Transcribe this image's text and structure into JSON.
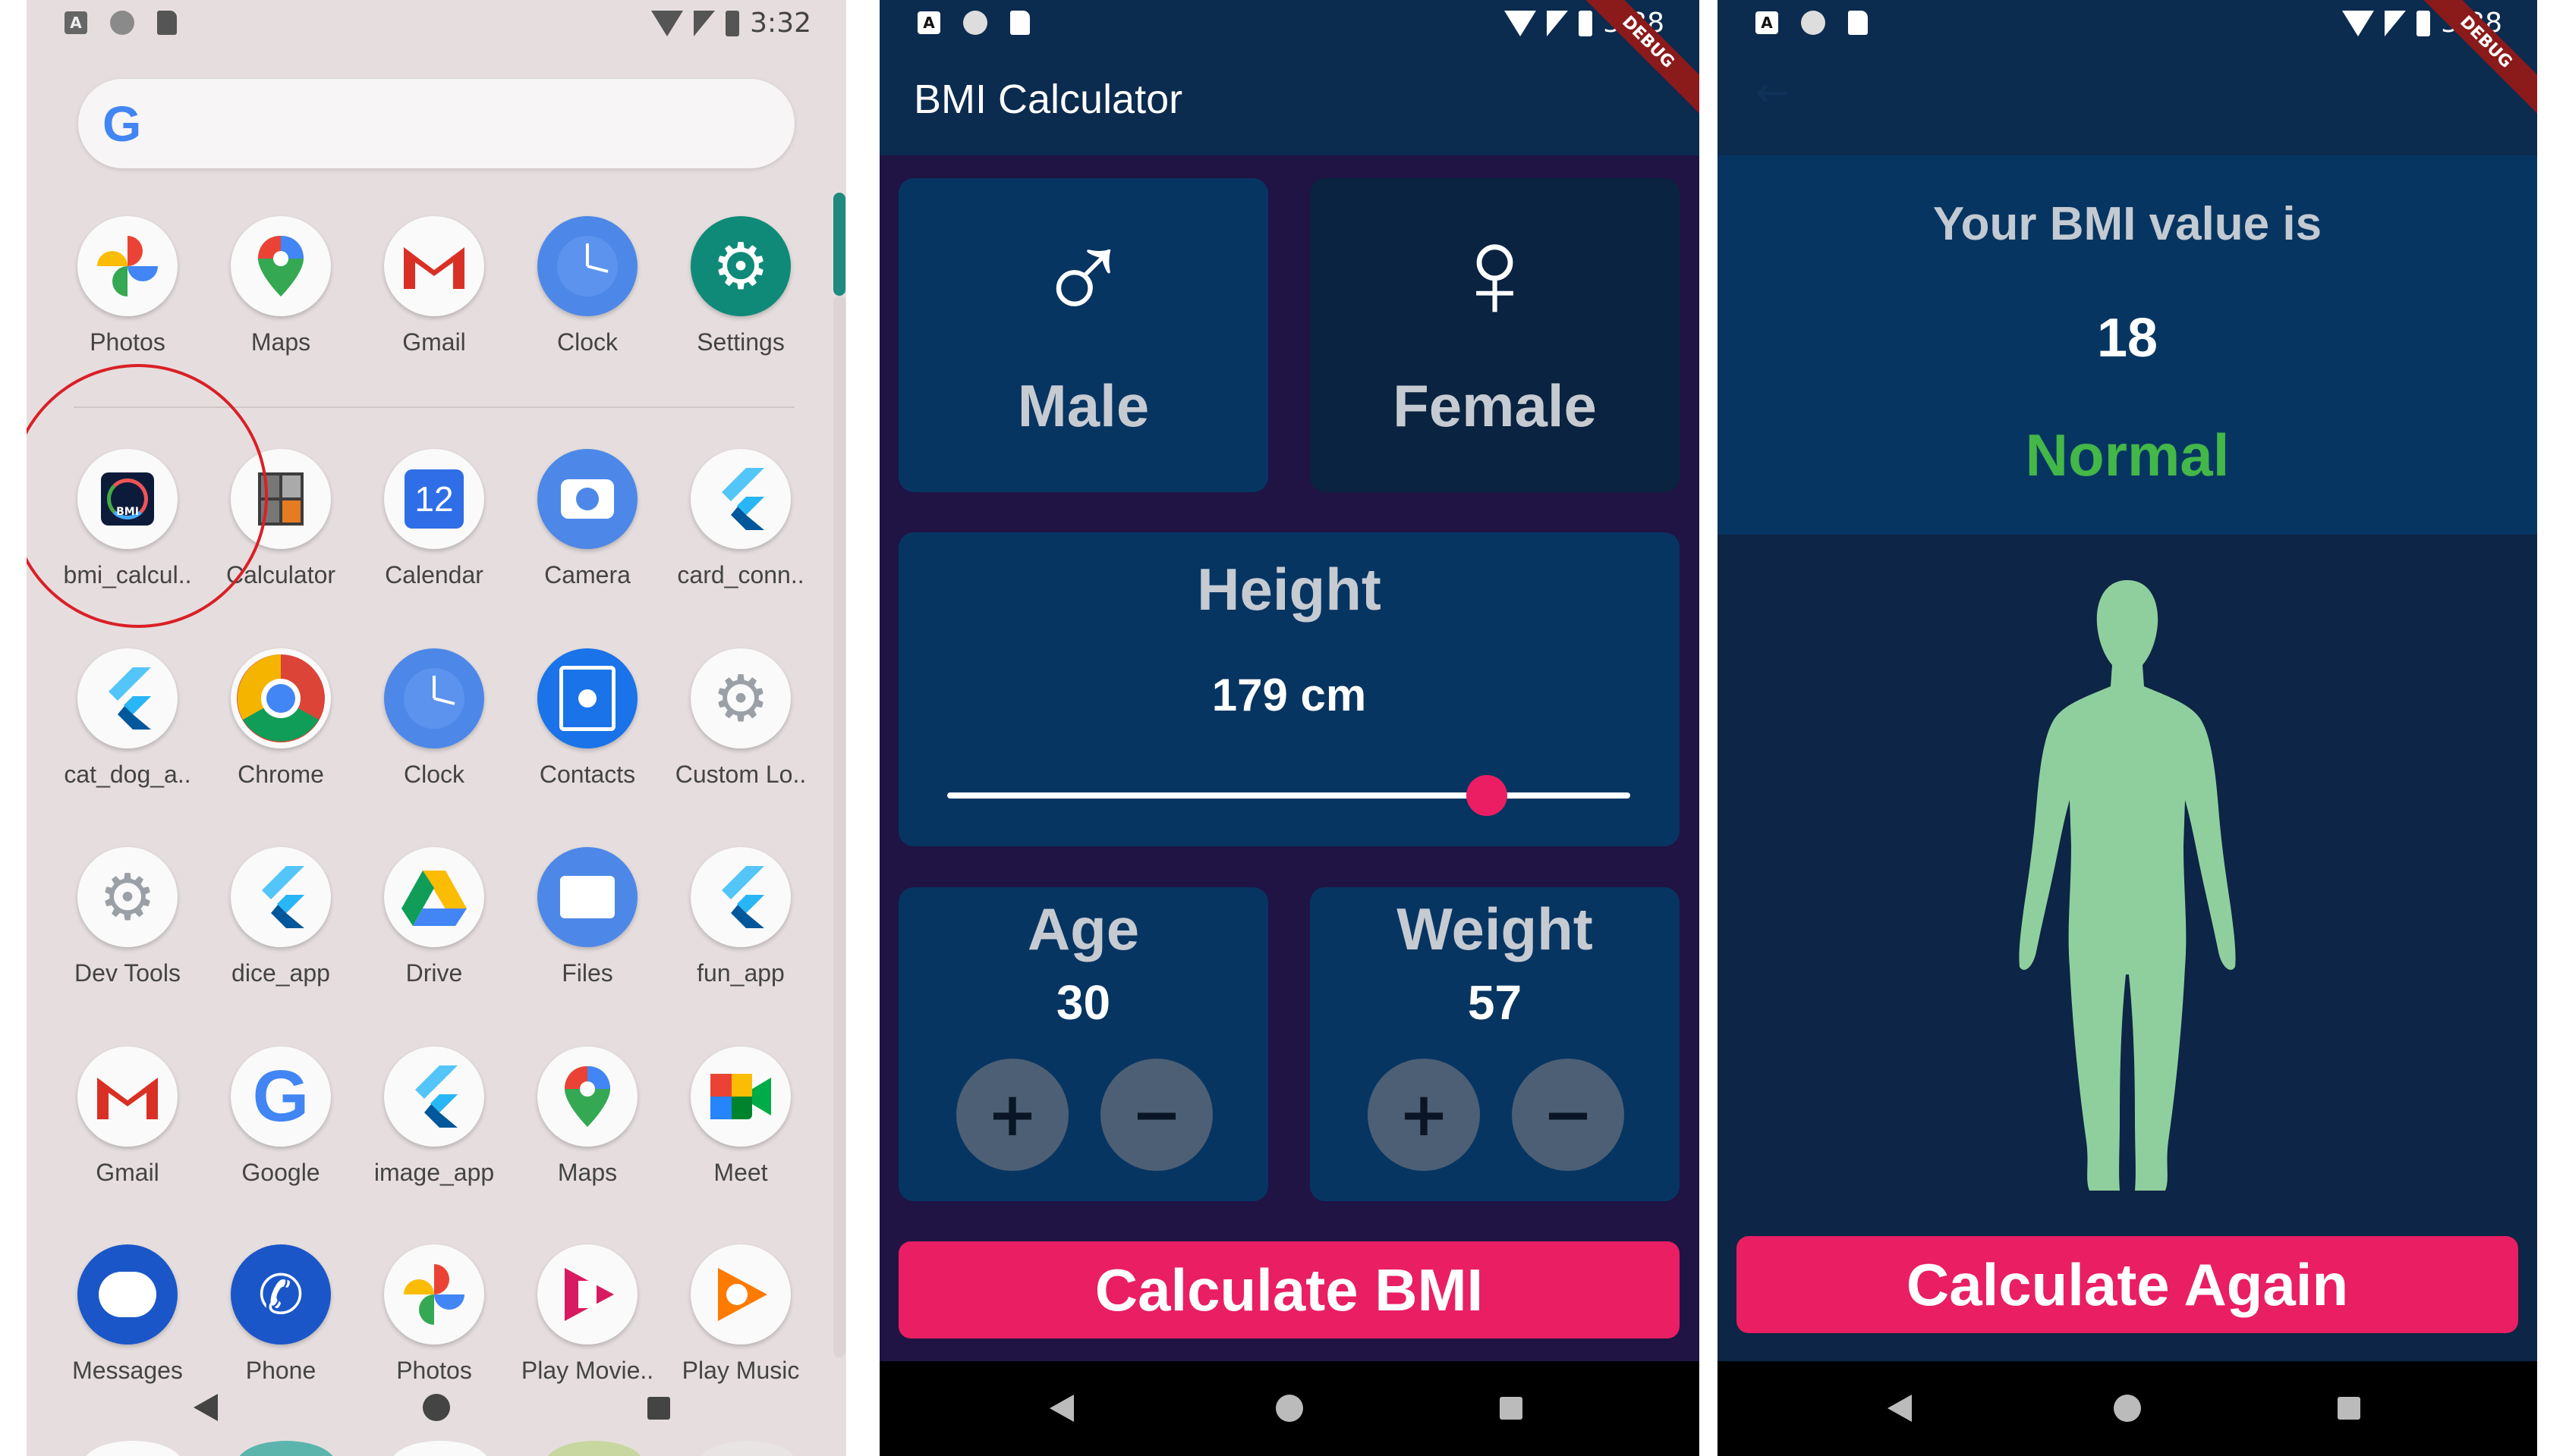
{
  "launcher": {
    "time": "3:32",
    "google_letter": "G",
    "apps": [
      {
        "label": "Photos",
        "icon": "photos-icon"
      },
      {
        "label": "Maps",
        "icon": "maps-icon"
      },
      {
        "label": "Gmail",
        "icon": "gmail-icon"
      },
      {
        "label": "Clock",
        "icon": "clock-icon"
      },
      {
        "label": "Settings",
        "icon": "settings-icon"
      },
      {
        "label": "bmi_calcul..",
        "icon": "bmi-app-icon",
        "badge": "BMI"
      },
      {
        "label": "Calculator",
        "icon": "calculator-icon"
      },
      {
        "label": "Calendar",
        "icon": "calendar-icon",
        "badge": "12"
      },
      {
        "label": "Camera",
        "icon": "camera-icon"
      },
      {
        "label": "card_conn..",
        "icon": "flutter-icon"
      },
      {
        "label": "cat_dog_a..",
        "icon": "flutter-icon"
      },
      {
        "label": "Chrome",
        "icon": "chrome-icon"
      },
      {
        "label": "Clock",
        "icon": "clock-icon"
      },
      {
        "label": "Contacts",
        "icon": "contacts-icon"
      },
      {
        "label": "Custom Lo..",
        "icon": "gear-flutter-icon"
      },
      {
        "label": "Dev Tools",
        "icon": "dev-tools-icon"
      },
      {
        "label": "dice_app",
        "icon": "flutter-icon"
      },
      {
        "label": "Drive",
        "icon": "drive-icon"
      },
      {
        "label": "Files",
        "icon": "files-icon"
      },
      {
        "label": "fun_app",
        "icon": "flutter-icon"
      },
      {
        "label": "Gmail",
        "icon": "gmail-icon"
      },
      {
        "label": "Google",
        "icon": "google-icon"
      },
      {
        "label": "image_app",
        "icon": "flutter-icon"
      },
      {
        "label": "Maps",
        "icon": "maps-icon"
      },
      {
        "label": "Meet",
        "icon": "meet-icon"
      },
      {
        "label": "Messages",
        "icon": "messages-icon"
      },
      {
        "label": "Phone",
        "icon": "phone-icon"
      },
      {
        "label": "Photos",
        "icon": "photos-icon"
      },
      {
        "label": "Play Movie..",
        "icon": "play-movies-icon"
      },
      {
        "label": "Play Music",
        "icon": "play-music-icon"
      }
    ]
  },
  "calculator": {
    "time": "3:38",
    "debug_banner": "DEBUG",
    "title": "BMI Calculator",
    "male_label": "Male",
    "female_label": "Female",
    "male_symbol": "♂",
    "female_symbol": "♀",
    "height_title": "Height",
    "height_value": "179 cm",
    "height_slider_fraction": 0.79,
    "age_title": "Age",
    "age_value": "30",
    "weight_title": "Weight",
    "weight_value": "57",
    "plus": "+",
    "minus": "−",
    "calculate_label": "Calculate BMI"
  },
  "result": {
    "time": "3:38",
    "debug_banner": "DEBUG",
    "back_arrow": "←",
    "heading": "Your BMI value is",
    "bmi_value": "18",
    "status": "Normal",
    "status_color": "#43b748",
    "figure_color": "#8fcf9e",
    "again_label": "Calculate Again"
  },
  "colors": {
    "accent_pink": "#e91e63",
    "card_active": "#073562",
    "card_inactive": "#092340",
    "screen_bg": "#1f1444"
  }
}
